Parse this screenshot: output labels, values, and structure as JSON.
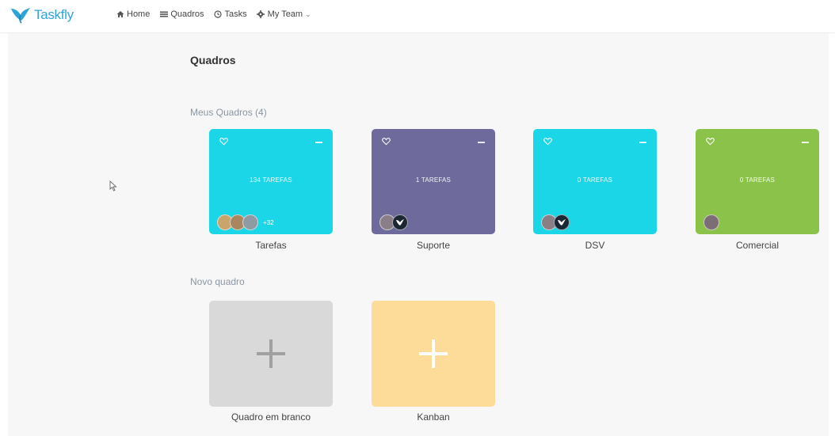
{
  "app": {
    "name": "Taskfly",
    "brand_color": "#2fa4d6"
  },
  "nav": {
    "home": {
      "label": "Home",
      "icon": "home-icon"
    },
    "boards": {
      "label": "Quadros",
      "icon": "list-icon"
    },
    "tasks": {
      "label": "Tasks",
      "icon": "clock-icon"
    },
    "team": {
      "label": "My Team",
      "icon": "gear-icon"
    }
  },
  "page": {
    "title": "Quadros",
    "my_boards_heading": "Meus Quadros (4)",
    "new_board_heading": "Novo quadro"
  },
  "boards": [
    {
      "name": "Tarefas",
      "count_label": "134 TAREFAS",
      "color": "#1bd6e6",
      "extra_members": "+32",
      "avatars": 3
    },
    {
      "name": "Suporte",
      "count_label": "1 TAREFAS",
      "color": "#6e6a9c",
      "extra_members": "",
      "avatars": 2
    },
    {
      "name": "DSV",
      "count_label": "0 TAREFAS",
      "color": "#1bd6e6",
      "extra_members": "",
      "avatars": 2
    },
    {
      "name": "Comercial",
      "count_label": "0 TAREFAS",
      "color": "#8bc34a",
      "extra_members": "",
      "avatars": 1
    }
  ],
  "templates": [
    {
      "name": "Quadro em branco",
      "color": "#d9d9d9",
      "plus_color": "#a0a0a0"
    },
    {
      "name": "Kanban",
      "color": "#fddb99",
      "plus_color": "#ffffff"
    }
  ]
}
